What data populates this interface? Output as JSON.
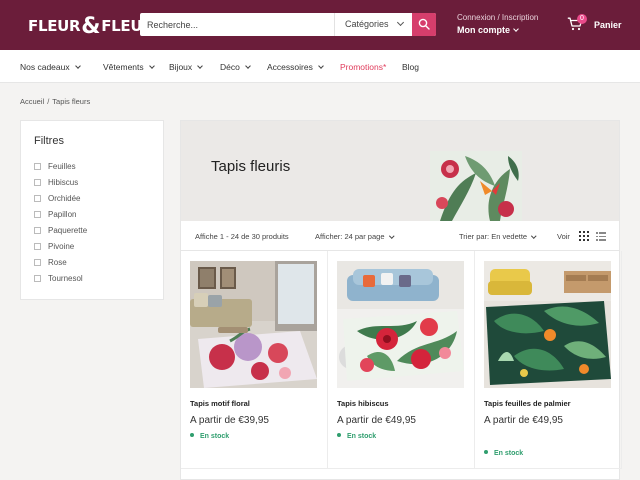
{
  "header": {
    "logo_left": "FLEUR",
    "logo_amp": "&",
    "logo_right": "FLEUR!",
    "search_placeholder": "Recherche...",
    "categories_label": "Catégories",
    "account_small": "Connexion / Inscription",
    "account_big": "Mon compte",
    "cart_count": "0",
    "cart_label": "Panier",
    "icons": [
      "search-icon",
      "cart-icon",
      "chevron-down-icon"
    ]
  },
  "colors": {
    "brand": "#6b1d3a",
    "accent": "#d63e6c",
    "promo": "#e03b5b",
    "in_stock": "#2f9e6e"
  },
  "nav": {
    "items": [
      {
        "label": "Nos cadeaux"
      },
      {
        "label": "Vêtements"
      },
      {
        "label": "Bijoux"
      },
      {
        "label": "Déco"
      },
      {
        "label": "Accessoires"
      },
      {
        "label": "Promotions*"
      },
      {
        "label": "Blog"
      }
    ]
  },
  "breadcrumb": {
    "home": "Accueil",
    "separator": "/",
    "current": "Tapis fleurs"
  },
  "filters": {
    "title": "Filtres",
    "options": [
      "Feuilles",
      "Hibiscus",
      "Orchidée",
      "Papillon",
      "Paquerette",
      "Pivoine",
      "Rose",
      "Tournesol"
    ]
  },
  "collection": {
    "title": "Tapis fleuris",
    "count_text": "Affiche 1 - 24 de 30 produits",
    "per_page": "Afficher: 24 par page",
    "sort": "Trier par: En vedette",
    "view_label": "Voir"
  },
  "products": [
    {
      "name": "Tapis motif floral",
      "price": "A partir de €39,95",
      "stock": "En stock"
    },
    {
      "name": "Tapis hibiscus",
      "price": "A partir de €49,95",
      "stock": "En stock"
    },
    {
      "name": "Tapis feuilles de palmier",
      "price": "A partir de €49,95",
      "stock": "En stock"
    }
  ]
}
